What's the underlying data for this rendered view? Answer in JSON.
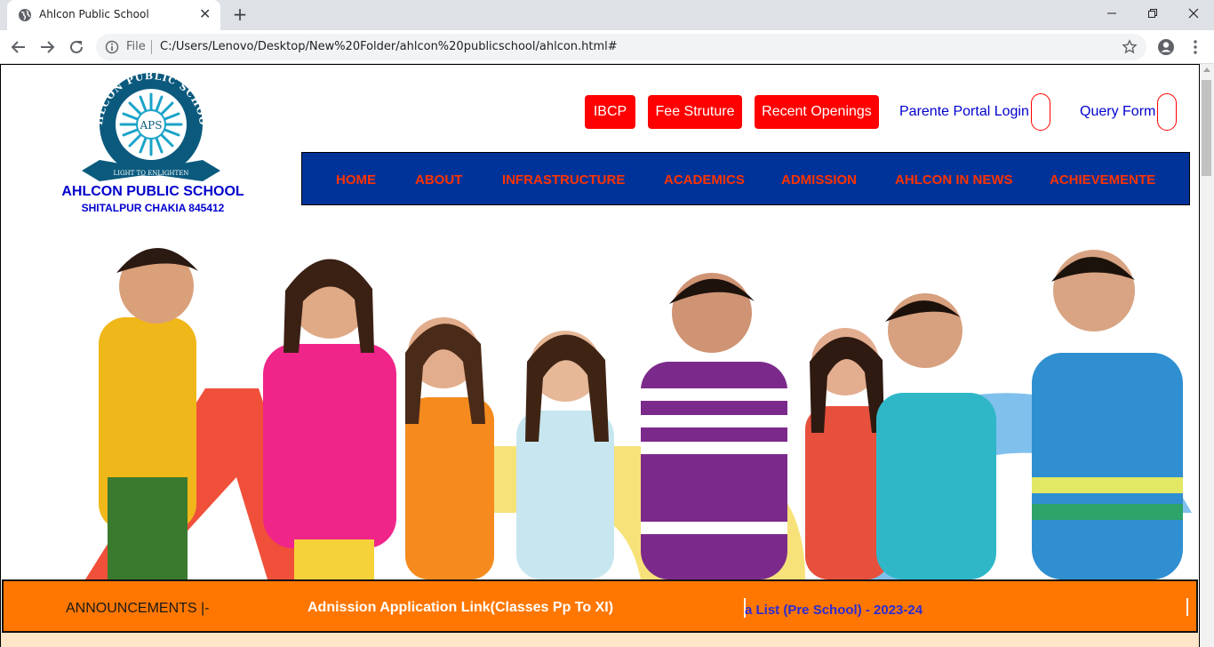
{
  "browser": {
    "tab_title": "Ahlcon Public School",
    "new_tab_glyph": "+",
    "close_glyph": "✕",
    "omnibox_scheme": "File",
    "url": "C:/Users/Lenovo/Desktop/New%20Folder/ahlcon%20publicschool/ahlcon.html#",
    "icons": [
      "globe-icon",
      "back-icon",
      "forward-icon",
      "reload-icon",
      "info-icon",
      "star-icon",
      "profile-icon",
      "kebab-menu-icon",
      "minimize-icon",
      "restore-icon",
      "close-window-icon"
    ]
  },
  "header": {
    "logo_ring_text": "AHLCON PUBLIC SCHOOL",
    "logo_banner_text": "LIGHT TO ENLIGHTEN",
    "logo_monogram": "APS",
    "school_name": "AHLCON PUBLIC SCHOOL",
    "school_address": "SHITALPUR CHAKIA 845412",
    "top_buttons": [
      {
        "label": "IBCP"
      },
      {
        "label": "Fee Struture"
      },
      {
        "label": "Recent Openings"
      }
    ],
    "top_links": [
      {
        "label": "Parente Portal Login"
      },
      {
        "label": "Query Form"
      }
    ]
  },
  "nav": {
    "items": [
      {
        "label": "HOME"
      },
      {
        "label": "ABOUT"
      },
      {
        "label": "INFRASTRUCTURE"
      },
      {
        "label": "ACADEMICS"
      },
      {
        "label": "ADMISSION"
      },
      {
        "label": "AHLCON IN NEWS"
      },
      {
        "label": "ACHIEVEMENTE"
      }
    ]
  },
  "announcements": {
    "label": "ANNOUNCEMENTS |-",
    "link": "Adnission Application Link(Classes Pp To XI)",
    "marquee": "a List (Pre School) - 2023-24"
  },
  "colors": {
    "nav_bg": "#003399",
    "nav_text": "#ff3300",
    "button_red": "#ff0000",
    "link_blue": "#0000cd",
    "announce_bg": "#ff7700"
  }
}
